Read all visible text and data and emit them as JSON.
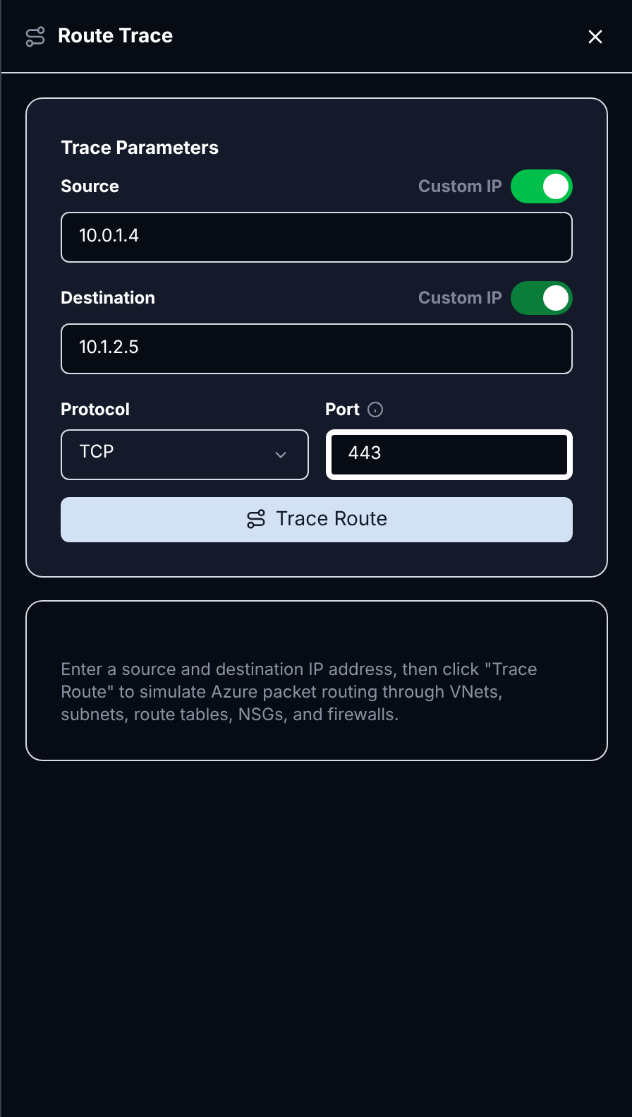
{
  "header": {
    "title": "Route Trace"
  },
  "parameters": {
    "title": "Trace Parameters",
    "endpoints": [
      {
        "label": "Source",
        "toggle_label": "Custom IP",
        "on": true,
        "color": "#00c04b",
        "value": "10.0.1.4"
      },
      {
        "label": "Destination",
        "toggle_label": "Custom IP",
        "on": true,
        "color": "#0a7d3a",
        "value": "10.1.2.5"
      }
    ],
    "protocol": {
      "label": "Protocol",
      "value": "TCP"
    },
    "port": {
      "label": "Port",
      "value": "443",
      "focused": true
    },
    "button": "Trace Route"
  },
  "hint": "Enter a source and destination IP address, then click \"Trace Route\" to simulate Azure packet routing through VNets, subnets, route tables, NSGs, and firewalls."
}
